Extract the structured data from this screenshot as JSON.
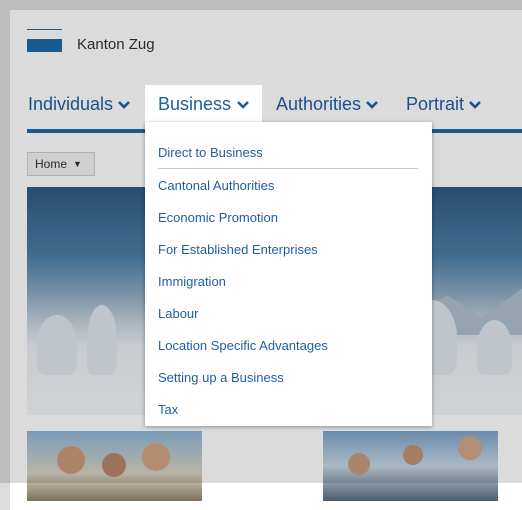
{
  "header": {
    "brand": "Kanton Zug"
  },
  "nav": {
    "items": [
      {
        "label": "Individuals"
      },
      {
        "label": "Business"
      },
      {
        "label": "Authorities"
      },
      {
        "label": "Portrait"
      }
    ],
    "active_index": 1
  },
  "breadcrumb": {
    "label": "Home",
    "caret": "▼"
  },
  "dropdown": {
    "top_item": "Direct to Business",
    "items": [
      "Cantonal Authorities",
      "Economic Promotion",
      "For Established Enterprises",
      "Immigration",
      "Labour",
      "Location Specific Advantages",
      "Setting up a Business",
      "Tax"
    ]
  },
  "colors": {
    "accent": "#1c6aa8",
    "link": "#1f5fa0"
  },
  "icons": {
    "nav_chevron": "chevron-down-icon",
    "breadcrumb_caret": "caret-down-icon"
  }
}
